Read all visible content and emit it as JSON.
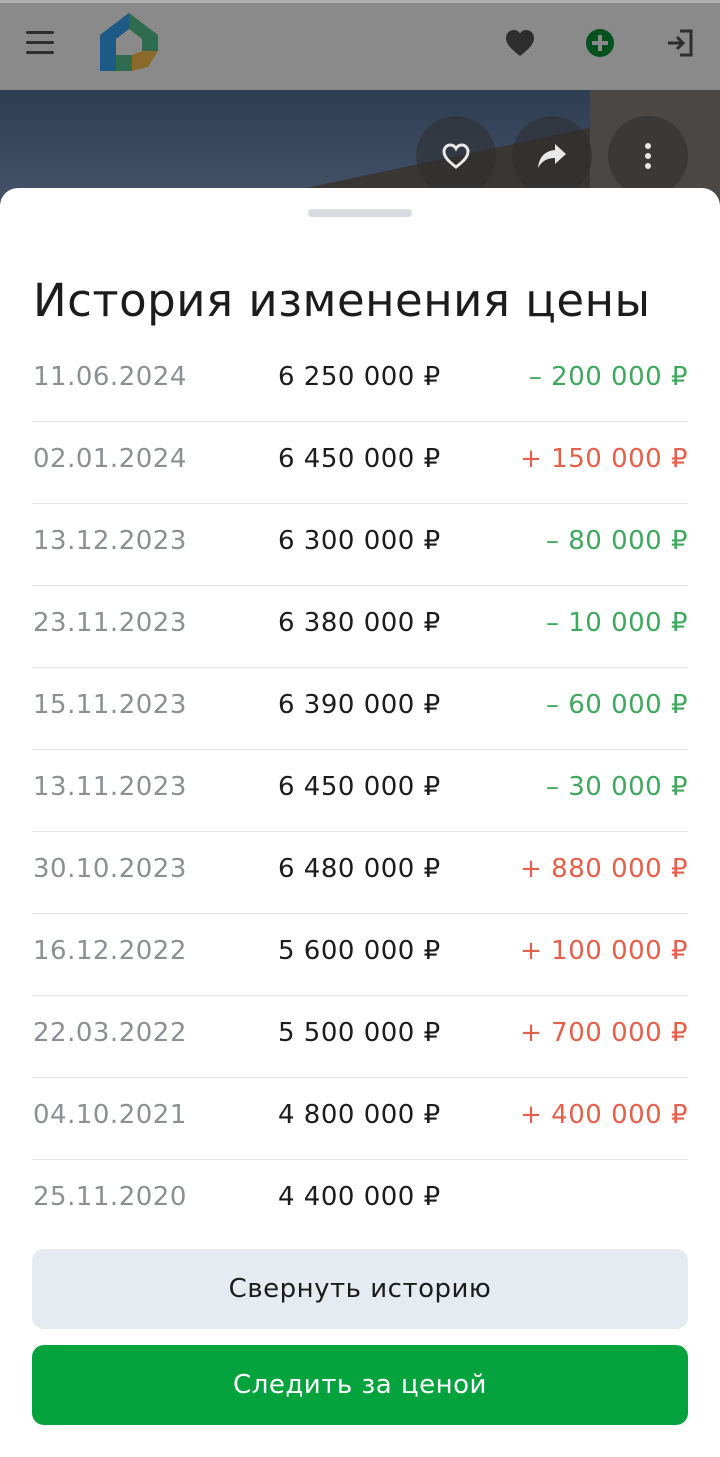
{
  "header": {
    "menu_icon": "hamburger-icon",
    "logo_icon": "house-logo-icon",
    "favorites_icon": "heart-icon",
    "add_icon": "plus-circle-icon",
    "login_icon": "sign-in-icon"
  },
  "photo_actions": {
    "favorite_icon": "heart-outline-icon",
    "share_icon": "share-arrow-icon",
    "more_icon": "more-vertical-icon"
  },
  "sheet": {
    "title": "История изменения цены",
    "rows": [
      {
        "date": "11.06.2024",
        "price": "6 250 000 ₽",
        "diff": "– 200 000 ₽",
        "direction": "down"
      },
      {
        "date": "02.01.2024",
        "price": "6 450 000 ₽",
        "diff": "+ 150 000 ₽",
        "direction": "up"
      },
      {
        "date": "13.12.2023",
        "price": "6 300 000 ₽",
        "diff": "– 80 000 ₽",
        "direction": "down"
      },
      {
        "date": "23.11.2023",
        "price": "6 380 000 ₽",
        "diff": "– 10 000 ₽",
        "direction": "down"
      },
      {
        "date": "15.11.2023",
        "price": "6 390 000 ₽",
        "diff": "– 60 000 ₽",
        "direction": "down"
      },
      {
        "date": "13.11.2023",
        "price": "6 450 000 ₽",
        "diff": "– 30 000 ₽",
        "direction": "down"
      },
      {
        "date": "30.10.2023",
        "price": "6 480 000 ₽",
        "diff": "+ 880 000 ₽",
        "direction": "up"
      },
      {
        "date": "16.12.2022",
        "price": "5 600 000 ₽",
        "diff": "+ 100 000 ₽",
        "direction": "up"
      },
      {
        "date": "22.03.2022",
        "price": "5 500 000 ₽",
        "diff": "+ 700 000 ₽",
        "direction": "up"
      },
      {
        "date": "04.10.2021",
        "price": "4 800 000 ₽",
        "diff": "+ 400 000 ₽",
        "direction": "up"
      },
      {
        "date": "25.11.2020",
        "price": "4 400 000 ₽",
        "diff": "",
        "direction": "none"
      }
    ],
    "collapse_label": "Свернуть историю",
    "track_label": "Следить за ценой"
  },
  "colors": {
    "accent_green": "#05a33d",
    "price_down": "#3fa85e",
    "price_up": "#e5604b"
  }
}
